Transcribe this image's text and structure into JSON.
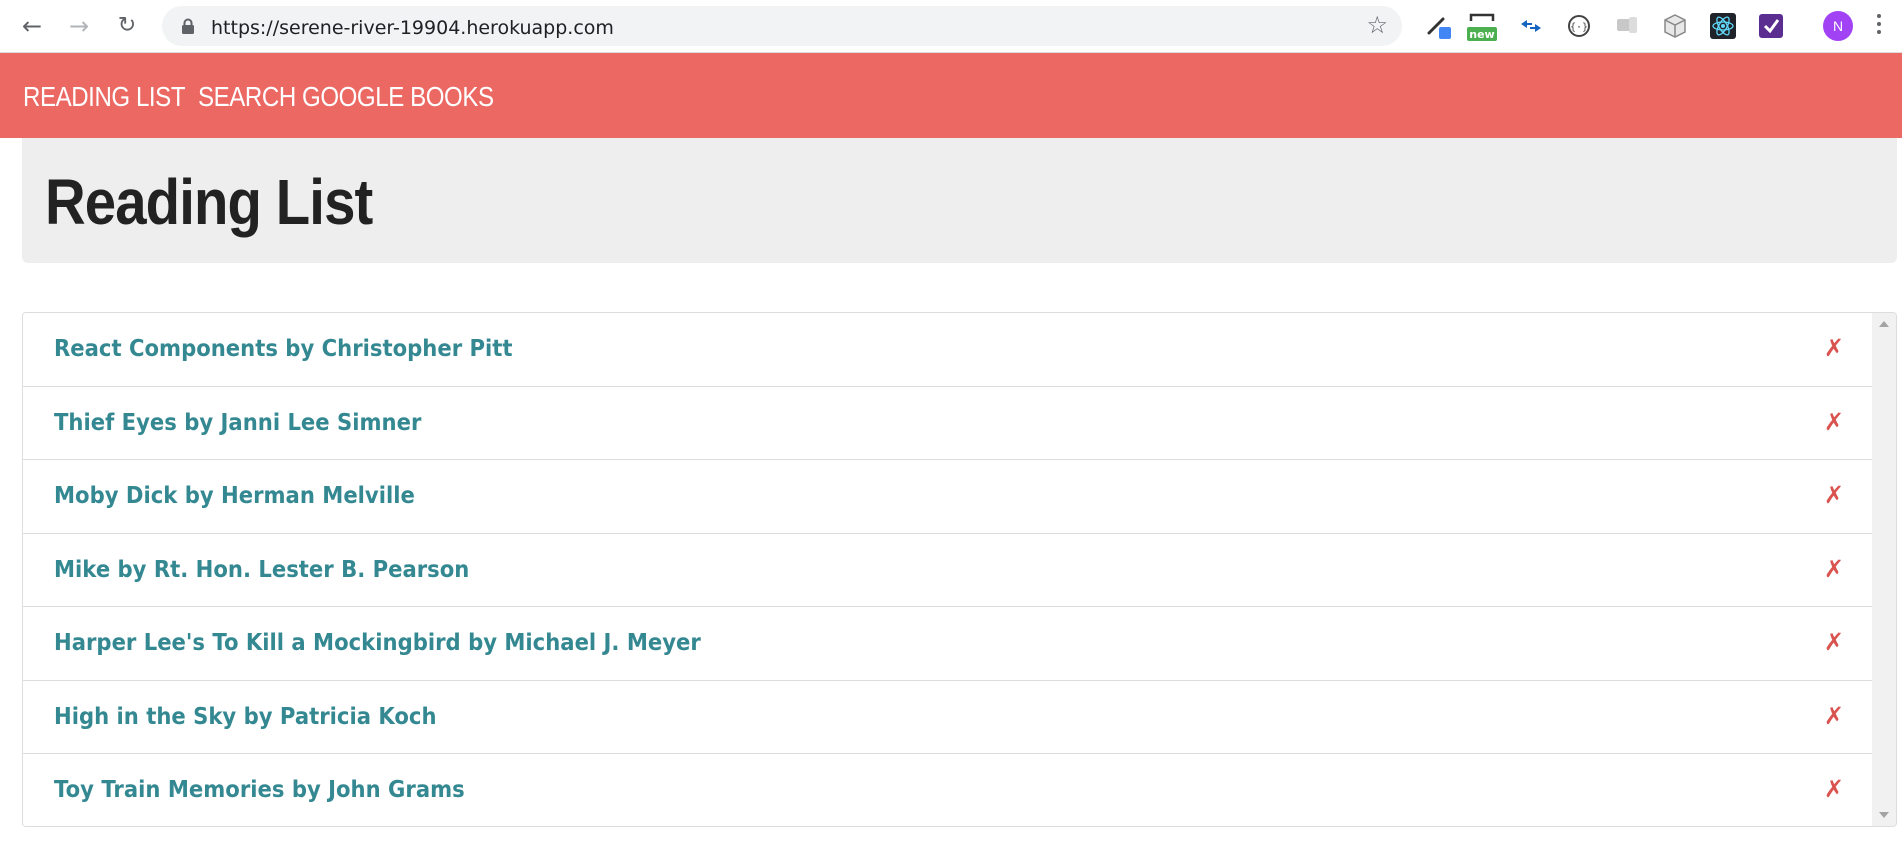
{
  "browser": {
    "back_icon": "←",
    "forward_icon": "→",
    "reload_icon": "↻",
    "url": "https://serene-river-19904.herokuapp.com",
    "star_icon": "☆",
    "ext_new_badge": "new",
    "avatar_initial": "N"
  },
  "navbar": {
    "links": [
      {
        "label": "READING LIST"
      },
      {
        "label": "SEARCH GOOGLE BOOKS"
      }
    ],
    "color": "#ec6863"
  },
  "page": {
    "title": "Reading List"
  },
  "books": [
    {
      "label": "React Components by Christopher Pitt",
      "remove": "✗"
    },
    {
      "label": "Thief Eyes by Janni Lee Simner",
      "remove": "✗"
    },
    {
      "label": "Moby Dick by Herman Melville",
      "remove": "✗"
    },
    {
      "label": "Mike by Rt. Hon. Lester B. Pearson",
      "remove": "✗"
    },
    {
      "label": "Harper Lee's To Kill a Mockingbird by Michael J. Meyer",
      "remove": "✗"
    },
    {
      "label": "High in the Sky by Patricia Koch",
      "remove": "✗"
    },
    {
      "label": "Toy Train Memories by John Grams",
      "remove": "✗"
    }
  ],
  "colors": {
    "link": "#348891",
    "remove": "#d9534f",
    "jumbotron": "#eeeeee"
  }
}
